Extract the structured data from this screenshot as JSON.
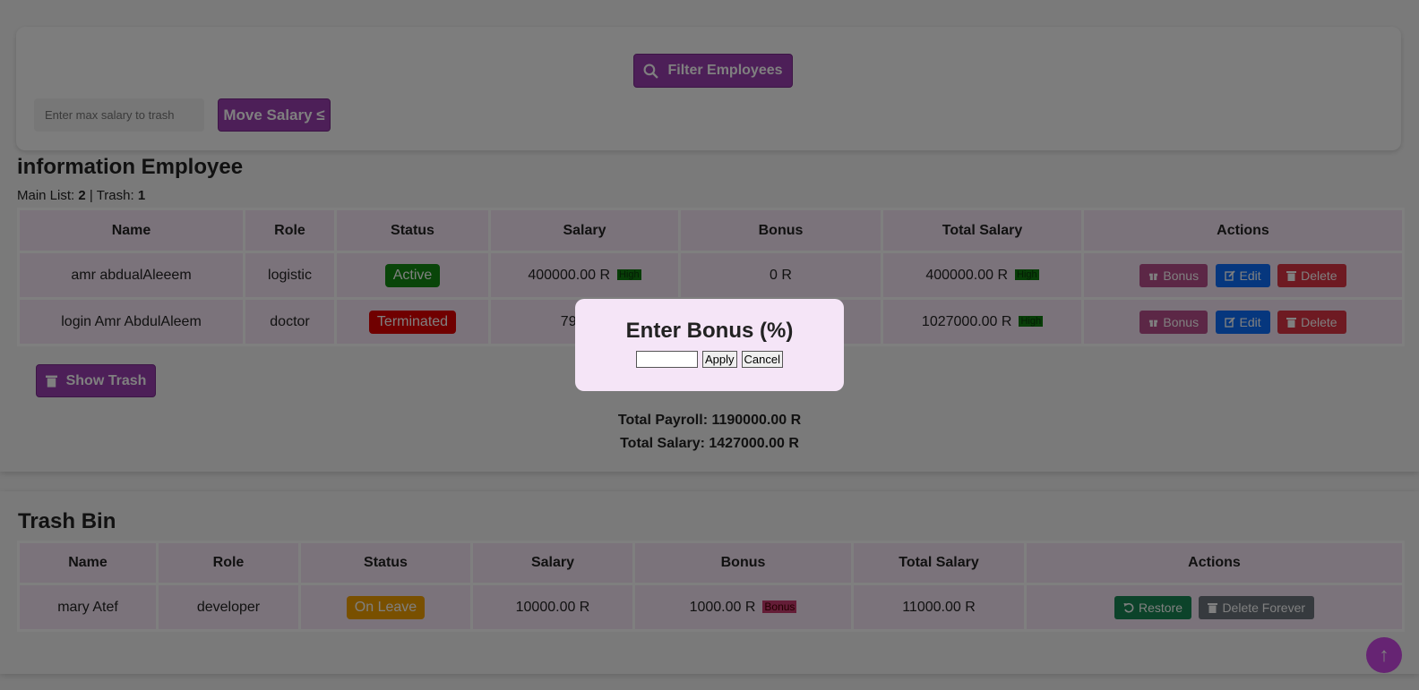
{
  "filter": {
    "button_label": "Filter Employees",
    "icon": "search-icon"
  },
  "move": {
    "placeholder": "Enter max salary to trash",
    "button_label": "Move Salary ≤"
  },
  "main": {
    "title": "information Employee",
    "counts_main_label": "Main List:",
    "counts_main_value": "2",
    "counts_sep": " | ",
    "counts_trash_label": "Trash:",
    "counts_trash_value": "1",
    "columns": [
      "Name",
      "Role",
      "Status",
      "Salary",
      "Bonus",
      "Total Salary",
      "Actions"
    ],
    "rows": [
      {
        "name": "amr abdualAleeem",
        "role": "logistic",
        "status": "Active",
        "salary": "400000.00 R",
        "salary_tag": "High",
        "bonus": "0 R",
        "total": "400000.00 R",
        "total_tag": "High"
      },
      {
        "name": "login Amr AbdulAleem",
        "role": "doctor",
        "status": "Terminated",
        "salary": "790000",
        "salary_tag": "",
        "bonus": "",
        "total": "1027000.00 R",
        "total_tag": "High"
      }
    ],
    "actions": {
      "bonus": "Bonus",
      "edit": "Edit",
      "delete": "Delete"
    },
    "show_trash": "Show Trash",
    "total_payroll": "Total Payroll: 1190000.00 R",
    "total_salary": "Total Salary: 1427000.00 R"
  },
  "trash": {
    "title": "Trash Bin",
    "columns": [
      "Name",
      "Role",
      "Status",
      "Salary",
      "Bonus",
      "Total Salary",
      "Actions"
    ],
    "rows": [
      {
        "name": "mary Atef",
        "role": "developer",
        "status": "On Leave",
        "salary": "10000.00 R",
        "bonus": "1000.00 R",
        "bonus_tag": "Bonus",
        "total": "11000.00 R"
      }
    ],
    "actions": {
      "restore": "Restore",
      "delete_forever": "Delete Forever"
    }
  },
  "modal": {
    "title": "Enter Bonus (%)",
    "apply": "Apply",
    "cancel": "Cancel",
    "input_value": ""
  },
  "scroll_top": "↑",
  "colors": {
    "purple": "#9b3fb0",
    "active": "#138a13",
    "terminated": "#e00000",
    "on_leave": "#f2a100"
  }
}
